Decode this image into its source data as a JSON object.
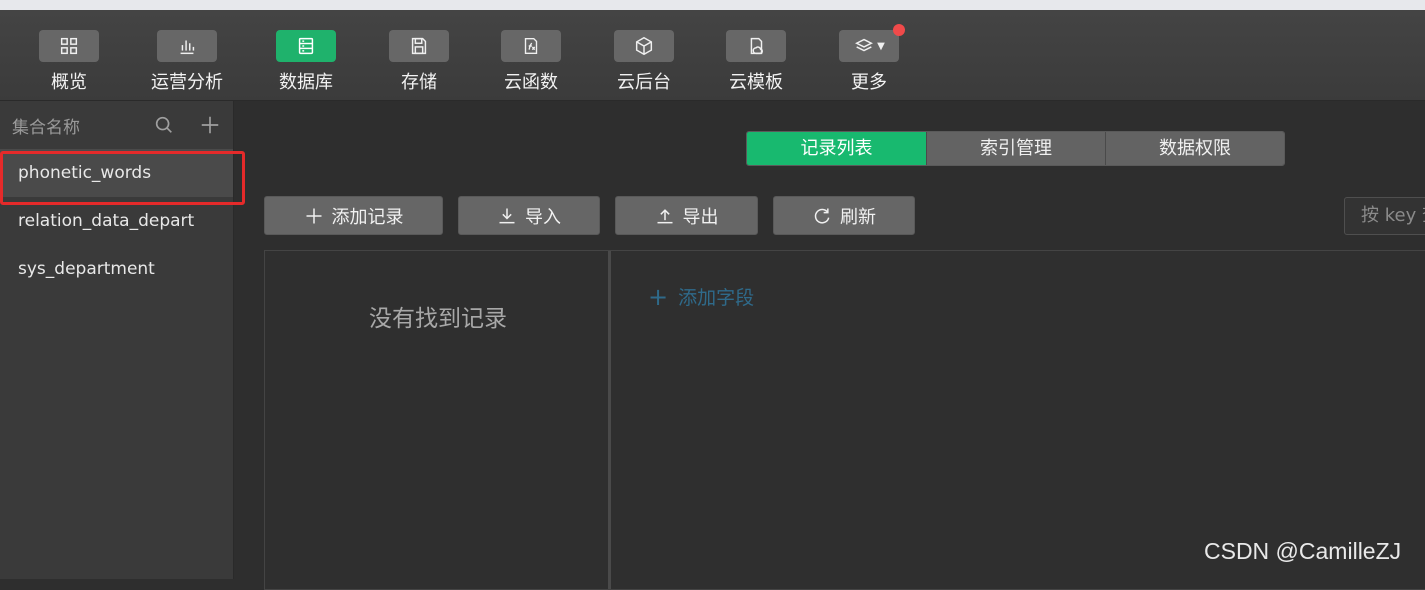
{
  "toolbar": {
    "items": [
      {
        "label": "概览",
        "icon": "grid-icon"
      },
      {
        "label": "运营分析",
        "icon": "bar-chart-icon"
      },
      {
        "label": "数据库",
        "icon": "database-icon",
        "active": true
      },
      {
        "label": "存储",
        "icon": "save-icon"
      },
      {
        "label": "云函数",
        "icon": "function-icon"
      },
      {
        "label": "云后台",
        "icon": "cube-icon"
      },
      {
        "label": "云模板",
        "icon": "template-icon"
      },
      {
        "label": "更多",
        "icon": "layers-icon"
      }
    ],
    "accent": "#1fb26c",
    "notify_color": "#f04a4a"
  },
  "sidebar": {
    "title": "集合名称",
    "items": [
      {
        "label": "phonetic_words",
        "active": true
      },
      {
        "label": "relation_data_depart"
      },
      {
        "label": "sys_department"
      }
    ]
  },
  "tabs": [
    {
      "label": "记录列表",
      "active": true
    },
    {
      "label": "索引管理"
    },
    {
      "label": "数据权限"
    }
  ],
  "actions": {
    "add_record": "添加记录",
    "import": "导入",
    "export": "导出",
    "refresh": "刷新"
  },
  "search": {
    "placeholder": "按 key 查"
  },
  "records": {
    "empty_text": "没有找到记录"
  },
  "fields": {
    "add_label": "添加字段"
  },
  "watermark": "CSDN @CamilleZJ"
}
